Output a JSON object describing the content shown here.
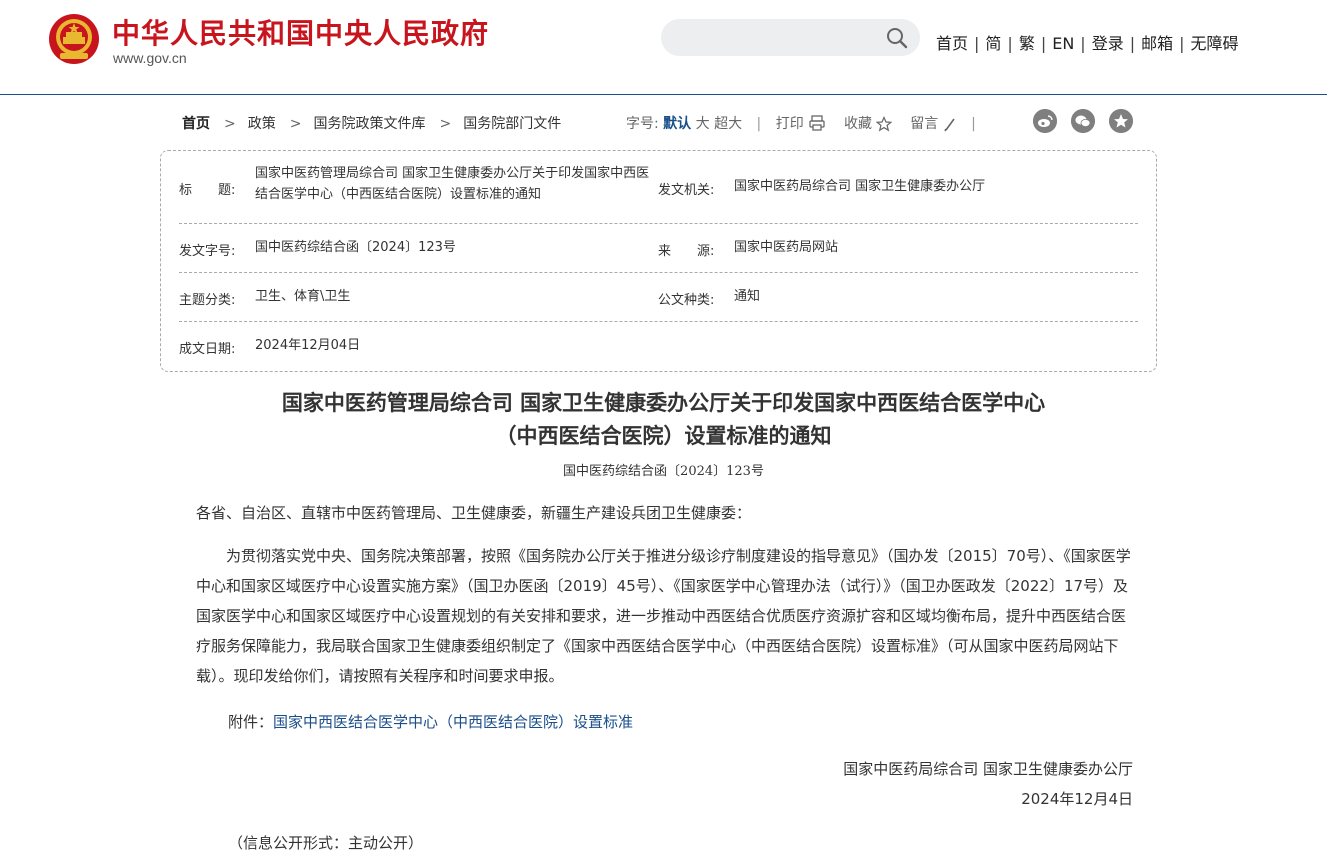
{
  "header": {
    "site_title": "中华人民共和国中央人民政府",
    "domain": "www.gov.cn",
    "nav": [
      "首页",
      "简",
      "繁",
      "EN",
      "登录",
      "邮箱",
      "无障碍"
    ],
    "colors": {
      "brand": "#c8151d",
      "accent": "#1a4e8a"
    }
  },
  "breadcrumb": [
    "首页",
    "政策",
    "国务院政策文件库",
    "国务院部门文件"
  ],
  "tools": {
    "font_label": "字号:",
    "font_default": "默认",
    "font_large": "大",
    "font_xlarge": "超大",
    "print": "打印",
    "favorite": "收藏",
    "comment": "留言"
  },
  "info": {
    "title_label": "标　　题:",
    "title_value": "国家中医药管理局综合司 国家卫生健康委办公厅关于印发国家中西医结合医学中心（中西医结合医院）设置标准的通知",
    "issuer_label": "发文机关:",
    "issuer_value": "国家中医药局综合司 国家卫生健康委办公厅",
    "docno_label": "发文字号:",
    "docno_value": "国中医药综结合函〔2024〕123号",
    "source_label": "来　　源:",
    "source_value": "国家中医药局网站",
    "topic_label": "主题分类:",
    "topic_value": "卫生、体育\\卫生",
    "type_label": "公文种类:",
    "type_value": "通知",
    "date_label": "成文日期:",
    "date_value": "2024年12月04日"
  },
  "article": {
    "title_line1": "国家中医药管理局综合司 国家卫生健康委办公厅关于印发国家中西医结合医学中心",
    "title_line2": "（中西医结合医院）设置标准的通知",
    "doc_no": "国中医药综结合函〔2024〕123号",
    "salutation": "各省、自治区、直辖市中医药管理局、卫生健康委，新疆生产建设兵团卫生健康委：",
    "body": "　　为贯彻落实党中央、国务院决策部署，按照《国务院办公厅关于推进分级诊疗制度建设的指导意见》（国办发〔2015〕70号）、《国家医学中心和国家区域医疗中心设置实施方案》（国卫办医函〔2019〕45号）、《国家医学中心管理办法（试行）》（国卫办医政发〔2022〕17号）及国家医学中心和国家区域医疗中心设置规划的有关安排和要求，进一步推动中西医结合优质医疗资源扩容和区域均衡布局，提升中西医结合医疗服务保障能力，我局联合国家卫生健康委组织制定了《国家中西医结合医学中心（中西医结合医院）设置标准》（可从国家中医药局网站下载）。现印发给你们，请按照有关程序和时间要求申报。",
    "attachment_label": "附件：",
    "attachment_link": "国家中西医结合医学中心（中西医结合医院）设置标准",
    "signature": "国家中医药局综合司 国家卫生健康委办公厅",
    "sign_date": "2024年12月4日",
    "open_form": "（信息公开形式：主动公开）"
  }
}
